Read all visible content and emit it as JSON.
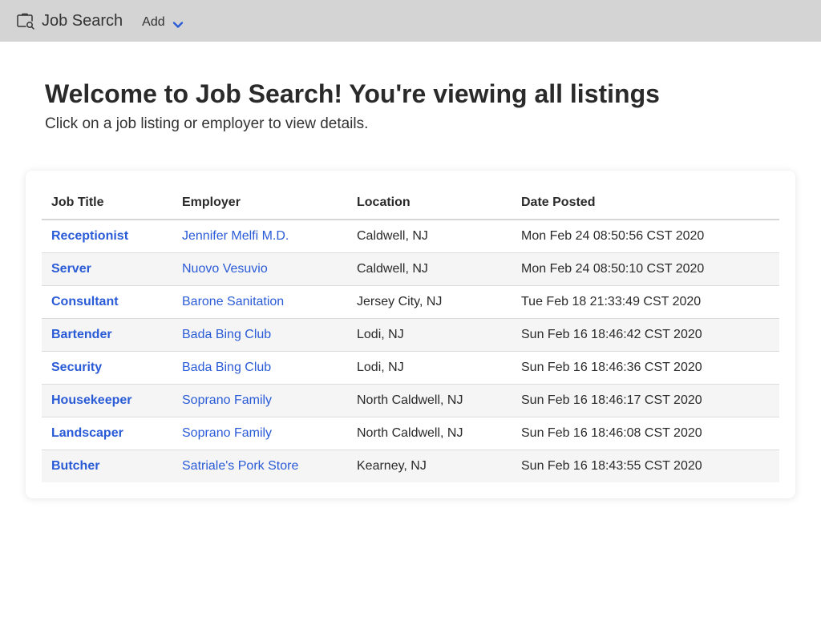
{
  "navbar": {
    "brand_label": "Job Search",
    "brand_icon": "briefcase-search-icon",
    "add_label": "Add",
    "add_icon": "chevron-down-icon",
    "background": "#d4d4d4",
    "accent": "#2a5bd7"
  },
  "header": {
    "title": "Welcome to Job Search! You're viewing all listings",
    "subtitle": "Click on a job listing or employer to view details."
  },
  "table": {
    "columns": [
      "Job Title",
      "Employer",
      "Location",
      "Date Posted"
    ],
    "rows": [
      {
        "title": "Receptionist",
        "employer": "Jennifer Melfi M.D.",
        "location": "Caldwell, NJ",
        "date": "Mon Feb 24 08:50:56 CST 2020"
      },
      {
        "title": "Server",
        "employer": "Nuovo Vesuvio",
        "location": "Caldwell, NJ",
        "date": "Mon Feb 24 08:50:10 CST 2020"
      },
      {
        "title": "Consultant",
        "employer": "Barone Sanitation",
        "location": "Jersey City, NJ",
        "date": "Tue Feb 18 21:33:49 CST 2020"
      },
      {
        "title": "Bartender",
        "employer": "Bada Bing Club",
        "location": "Lodi, NJ",
        "date": "Sun Feb 16 18:46:42 CST 2020"
      },
      {
        "title": "Security",
        "employer": "Bada Bing Club",
        "location": "Lodi, NJ",
        "date": "Sun Feb 16 18:46:36 CST 2020"
      },
      {
        "title": "Housekeeper",
        "employer": "Soprano Family",
        "location": "North Caldwell, NJ",
        "date": "Sun Feb 16 18:46:17 CST 2020"
      },
      {
        "title": "Landscaper",
        "employer": "Soprano Family",
        "location": "North Caldwell, NJ",
        "date": "Sun Feb 16 18:46:08 CST 2020"
      },
      {
        "title": "Butcher",
        "employer": "Satriale's Pork Store",
        "location": "Kearney, NJ",
        "date": "Sun Feb 16 18:43:55 CST 2020"
      }
    ]
  }
}
